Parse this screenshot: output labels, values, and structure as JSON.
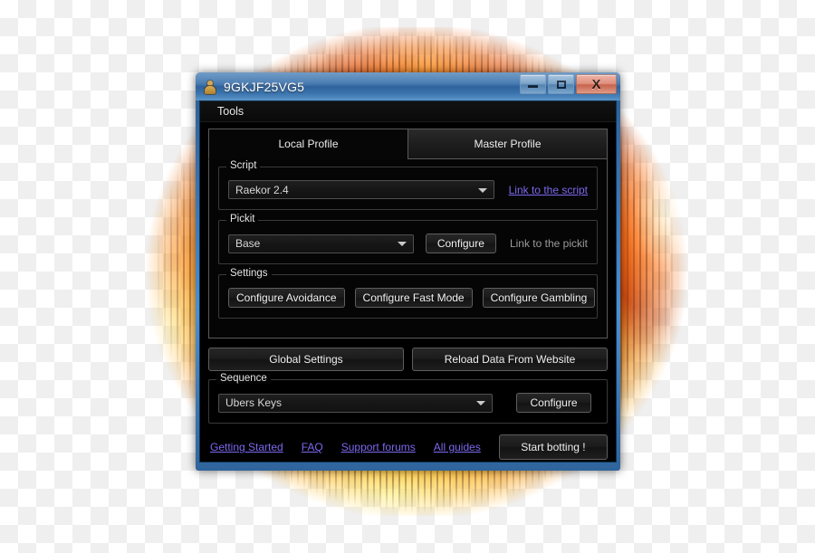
{
  "window": {
    "title": "9GKJF25VG5",
    "icon": "user-figure-icon",
    "controls": {
      "minimize": "minimize-icon",
      "maximize": "maximize-icon",
      "close": "X"
    }
  },
  "menu": {
    "items": [
      {
        "label": "Tools"
      }
    ]
  },
  "tabs": [
    {
      "label": "Local Profile",
      "active": true
    },
    {
      "label": "Master Profile",
      "active": false
    }
  ],
  "script_group": {
    "title": "Script",
    "combo_value": "Raekor 2.4",
    "link_label": "Link to the script"
  },
  "pickit_group": {
    "title": "Pickit",
    "combo_value": "Base",
    "configure_label": "Configure",
    "link_label": "Link to the pickit"
  },
  "settings_group": {
    "title": "Settings",
    "buttons": [
      {
        "label": "Configure Avoidance"
      },
      {
        "label": "Configure Fast Mode"
      },
      {
        "label": "Configure Gambling"
      }
    ]
  },
  "main_buttons": [
    {
      "label": "Global Settings"
    },
    {
      "label": "Reload Data From Website"
    }
  ],
  "sequence_group": {
    "title": "Sequence",
    "combo_value": "Ubers Keys",
    "configure_label": "Configure"
  },
  "footer": {
    "links": [
      {
        "label": "Getting Started"
      },
      {
        "label": "FAQ"
      },
      {
        "label": "Support forums"
      },
      {
        "label": "All guides"
      }
    ],
    "start_button_label": "Start botting !"
  },
  "colors": {
    "link": "#7b68ee",
    "titlebar_blue": "#3d74ae",
    "close_red": "#c55f49",
    "panel_black": "#050505",
    "flame_orange": "#ef7a1e",
    "flame_yellow": "#ffd84a"
  }
}
